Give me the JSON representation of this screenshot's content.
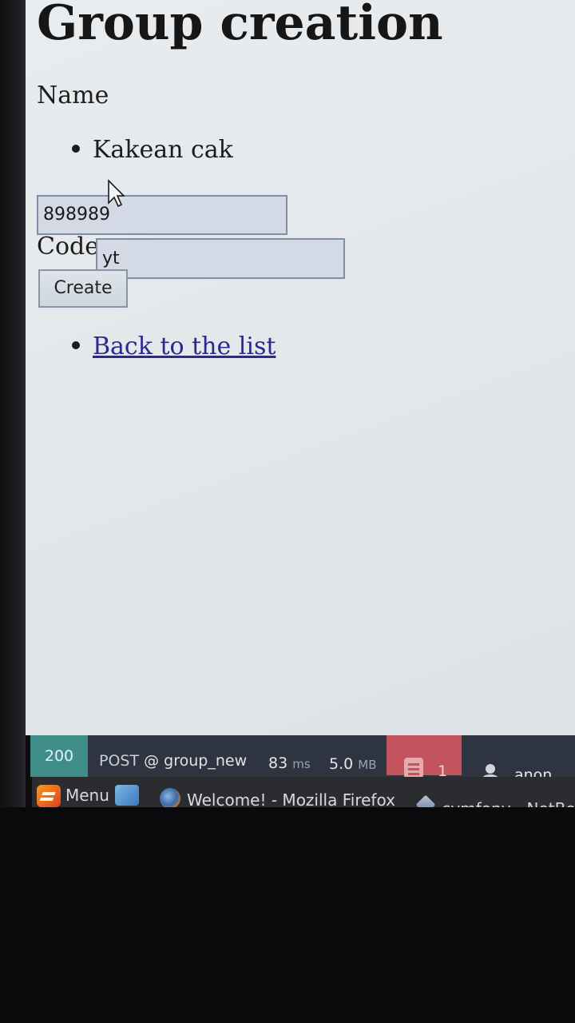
{
  "page": {
    "title": "Group creation",
    "name_label": "Name",
    "errors": [
      "Kakean cak"
    ],
    "name_value": "898989",
    "code_label": "Code",
    "code_value": "yt",
    "create_label": "Create",
    "back_link_label": "Back to the list"
  },
  "debug_toolbar": {
    "status_code": "200",
    "method": "POST",
    "route": "@ group_new",
    "time_value": "83",
    "time_unit": "ms",
    "memory_value": "5.0",
    "memory_unit": "MB",
    "log_count": "1",
    "user": "anon."
  },
  "taskbar": {
    "menu_label": "Menu",
    "tasks": [
      {
        "label": "Welcome! - Mozilla Firefox",
        "icon": "firefox-icon"
      },
      {
        "label": "symfony - NetBea",
        "icon": "netbeans-icon"
      }
    ]
  },
  "colors": {
    "toolbar_bg": "#2e3541",
    "status_ok": "#3f8e8a",
    "log_panel": "#c3545e",
    "link": "#2a2a8c",
    "input_bg": "#d3dae6"
  }
}
